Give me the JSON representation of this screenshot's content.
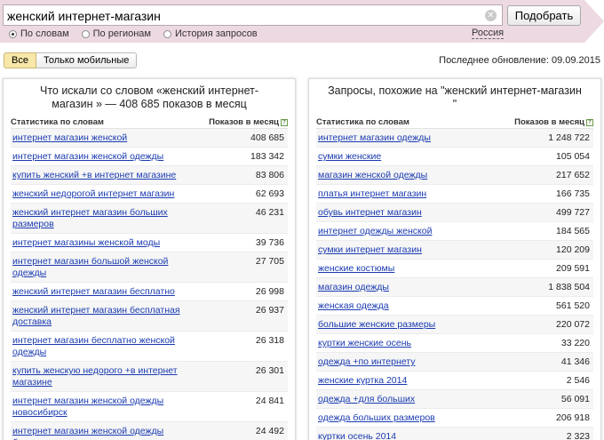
{
  "search": {
    "value": "женский интернет-магазин",
    "submit_label": "Подобрать",
    "modes": [
      {
        "label": "По словам",
        "selected": true
      },
      {
        "label": "По регионам",
        "selected": false
      },
      {
        "label": "История запросов",
        "selected": false
      }
    ],
    "region": "Россия"
  },
  "filters": {
    "all": "Все",
    "mobile": "Только мобильные"
  },
  "last_update": "Последнее обновление: 09.09.2015",
  "left_panel": {
    "title": "Что искали со словом «женский интернет-магазин » — 408 685 показов в месяц",
    "col1": "Статистика по словам",
    "col2": "Показов в месяц",
    "rows": [
      {
        "kw": "интернет магазин женской",
        "count": "408 685"
      },
      {
        "kw": "интернет магазин женской одежды",
        "count": "183 342"
      },
      {
        "kw": "купить женский +в интернет магазине",
        "count": "83 806"
      },
      {
        "kw": "женский недорогой интернет магазин",
        "count": "62 693"
      },
      {
        "kw": "женский интернет магазин больших размеров",
        "count": "46 231"
      },
      {
        "kw": "интернет магазины женской моды",
        "count": "39 736"
      },
      {
        "kw": "интернет магазин большой женской одежды",
        "count": "27 705"
      },
      {
        "kw": "женский интернет магазин бесплатно",
        "count": "26 998"
      },
      {
        "kw": "женский интернет магазин бесплатная доставка",
        "count": "26 937"
      },
      {
        "kw": "интернет магазин бесплатно женской одежды",
        "count": "26 318"
      },
      {
        "kw": "купить женскую недорого +в интернет магазине",
        "count": "26 301"
      },
      {
        "kw": "интернет магазин женской одежды новосибирск",
        "count": "24 841"
      },
      {
        "kw": "интернет магазин женской одежды больших размеров",
        "count": "24 492"
      }
    ]
  },
  "right_panel": {
    "title": "Запросы, похожие на \"женский интернет-магазин \"",
    "col1": "Статистика по словам",
    "col2": "Показов в месяц",
    "rows": [
      {
        "kw": "интернет магазин одежды",
        "count": "1 248 722"
      },
      {
        "kw": "сумки женские",
        "count": "105 054"
      },
      {
        "kw": "магазин женской одежды",
        "count": "217 652"
      },
      {
        "kw": "платья интернет магазин",
        "count": "166 735"
      },
      {
        "kw": "обувь интернет магазин",
        "count": "499 727"
      },
      {
        "kw": "интернет одежды женской",
        "count": "184 565"
      },
      {
        "kw": "сумки интернет магазин",
        "count": "120 209"
      },
      {
        "kw": "женские костюмы",
        "count": "209 591"
      },
      {
        "kw": "магазин одежды",
        "count": "1 838 504"
      },
      {
        "kw": "женская одежда",
        "count": "561 520"
      },
      {
        "kw": "большие женские размеры",
        "count": "220 072"
      },
      {
        "kw": "куртки женские осень",
        "count": "33 220"
      },
      {
        "kw": "одежда +по интернету",
        "count": "41 346"
      },
      {
        "kw": "женские куртка 2014",
        "count": "2 546"
      },
      {
        "kw": "одежда +для больших",
        "count": "56 091"
      },
      {
        "kw": "одежда больших размеров",
        "count": "206 918"
      },
      {
        "kw": "куртки осень 2014",
        "count": "2 323"
      }
    ]
  }
}
